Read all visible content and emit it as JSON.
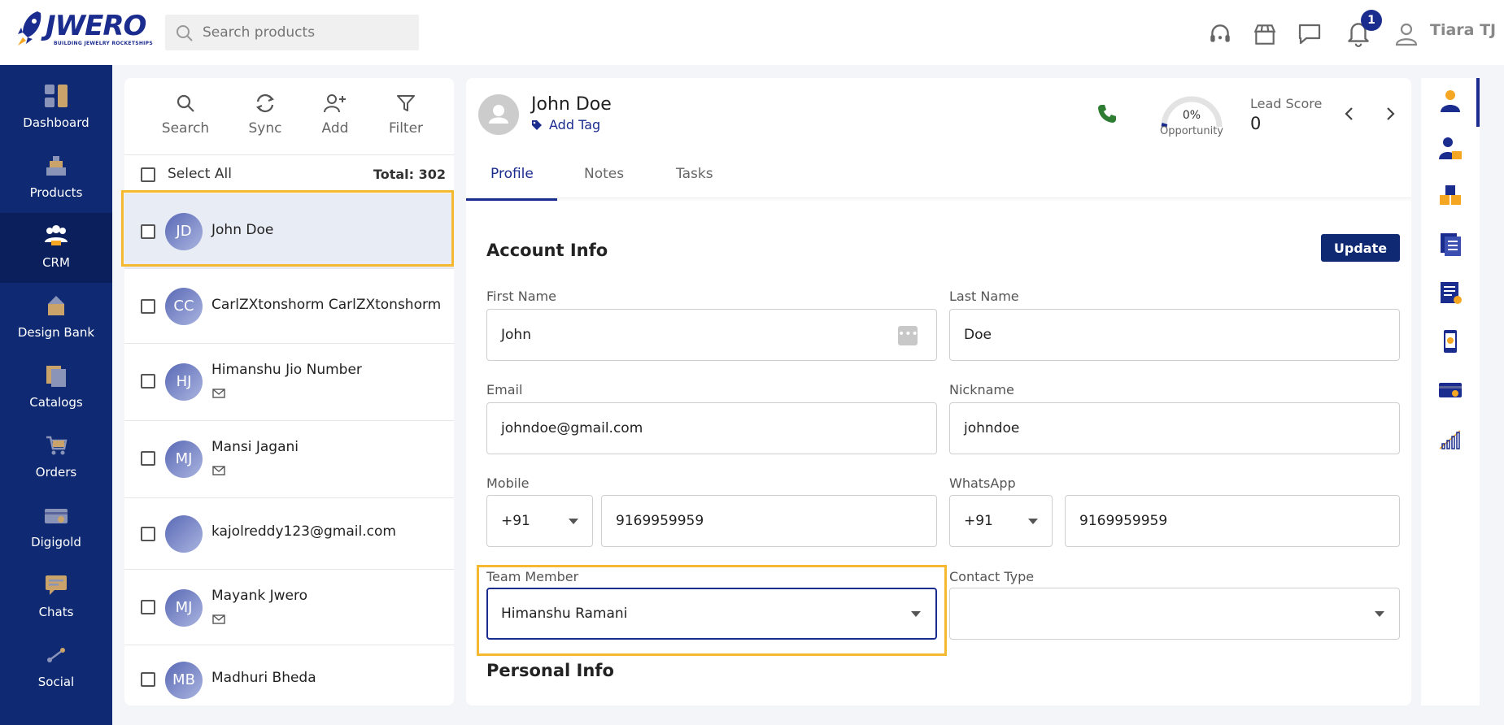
{
  "app": {
    "logo_text": "JWERO",
    "logo_tagline": "BUILDING JEWELRY ROCKETSHIPS",
    "search_placeholder": "Search products",
    "notification_count": "1",
    "user_name": "Tiara TJ"
  },
  "nav": {
    "items": [
      {
        "label": "Dashboard",
        "icon": "dashboard-icon"
      },
      {
        "label": "Products",
        "icon": "products-icon"
      },
      {
        "label": "CRM",
        "icon": "crm-icon",
        "active": true
      },
      {
        "label": "Design Bank",
        "icon": "design-bank-icon"
      },
      {
        "label": "Catalogs",
        "icon": "catalogs-icon"
      },
      {
        "label": "Orders",
        "icon": "cart-icon"
      },
      {
        "label": "Digigold",
        "icon": "digigold-icon"
      },
      {
        "label": "Chats",
        "icon": "chat-icon"
      },
      {
        "label": "Social",
        "icon": "social-icon"
      }
    ]
  },
  "list": {
    "tools": {
      "search": "Search",
      "sync": "Sync",
      "add": "Add",
      "filter": "Filter"
    },
    "select_all": "Select All",
    "total": "Total: 302",
    "contacts": [
      {
        "initials": "JD",
        "name": "John Doe",
        "mail": false
      },
      {
        "initials": "CC",
        "name": "CarlZXtonshorm CarlZXtonshorm",
        "mail": false
      },
      {
        "initials": "HJ",
        "name": "Himanshu Jio Number",
        "mail": true
      },
      {
        "initials": "MJ",
        "name": "Mansi Jagani",
        "mail": true
      },
      {
        "initials": "",
        "name": "kajolreddy123@gmail.com",
        "mail": false
      },
      {
        "initials": "MJ",
        "name": "Mayank Jwero",
        "mail": true
      },
      {
        "initials": "MB",
        "name": "Madhuri Bheda",
        "mail": false
      }
    ]
  },
  "profile": {
    "name": "John Doe",
    "add_tag": "Add Tag",
    "opportunity_value": "0%",
    "opportunity_label": "Opportunity",
    "opportunity_fraction": 0.0,
    "lead_score_label": "Lead Score",
    "lead_score": "0"
  },
  "tabs": [
    "Profile",
    "Notes",
    "Tasks"
  ],
  "account": {
    "title": "Account Info",
    "update_label": "Update",
    "first_name_label": "First Name",
    "first_name": "John",
    "last_name_label": "Last Name",
    "last_name": "Doe",
    "email_label": "Email",
    "email": "johndoe@gmail.com",
    "nickname_label": "Nickname",
    "nickname": "johndoe",
    "mobile_label": "Mobile",
    "mobile_code": "+91",
    "mobile": "9169959959",
    "whatsapp_label": "WhatsApp",
    "whatsapp_code": "+91",
    "whatsapp": "9169959959",
    "team_member_label": "Team Member",
    "team_member": "Himanshu Ramani",
    "contact_type_label": "Contact Type",
    "contact_type": ""
  },
  "personal": {
    "title": "Personal Info"
  },
  "colors": {
    "brand": "#0f2a72",
    "accent": "#f5a623",
    "highlight": "#f5b82e",
    "phone": "#2e7d32"
  }
}
